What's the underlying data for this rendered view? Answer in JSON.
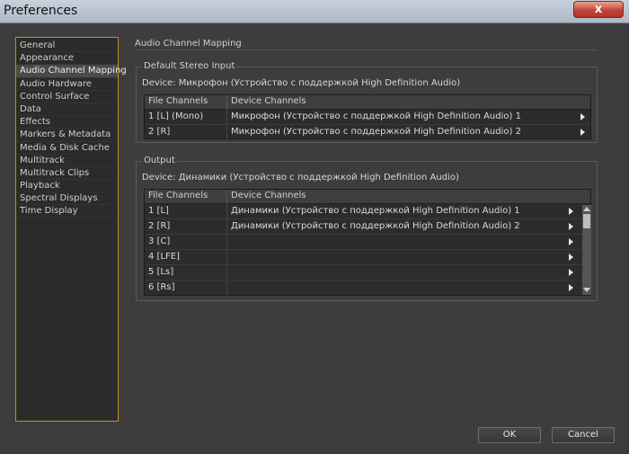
{
  "window": {
    "title": "Preferences",
    "close_glyph": "x"
  },
  "sidebar": {
    "items": [
      "General",
      "Appearance",
      "Audio Channel Mapping",
      "Audio Hardware",
      "Control Surface",
      "Data",
      "Effects",
      "Markers & Metadata",
      "Media & Disk Cache",
      "Multitrack",
      "Multitrack Clips",
      "Playback",
      "Spectral Displays",
      "Time Display"
    ],
    "selected": "Audio Channel Mapping"
  },
  "page": {
    "title": "Audio Channel Mapping"
  },
  "stereo_input": {
    "legend": "Default Stereo Input",
    "device": "Device: Микрофон (Устройство с поддержкой High Definition Audio)",
    "columns": [
      "File Channels",
      "Device Channels"
    ],
    "rows": [
      {
        "file": "1 [L] (Mono)",
        "device": "Микрофон (Устройство с поддержкой High Definition Audio) 1"
      },
      {
        "file": "2 [R]",
        "device": "Микрофон (Устройство с поддержкой High Definition Audio) 2"
      }
    ]
  },
  "output": {
    "legend": "Output",
    "device": "Device: Динамики (Устройство с поддержкой High Definition Audio)",
    "columns": [
      "File Channels",
      "Device Channels"
    ],
    "rows": [
      {
        "file": "1 [L]",
        "device": "Динамики (Устройство с поддержкой High Definition Audio) 1"
      },
      {
        "file": "2 [R]",
        "device": "Динамики (Устройство с поддержкой High Definition Audio) 2"
      },
      {
        "file": "3 [C]",
        "device": ""
      },
      {
        "file": "4 [LFE]",
        "device": ""
      },
      {
        "file": "5 [Ls]",
        "device": ""
      },
      {
        "file": "6 [Rs]",
        "device": ""
      }
    ]
  },
  "buttons": {
    "ok": "OK",
    "cancel": "Cancel"
  }
}
